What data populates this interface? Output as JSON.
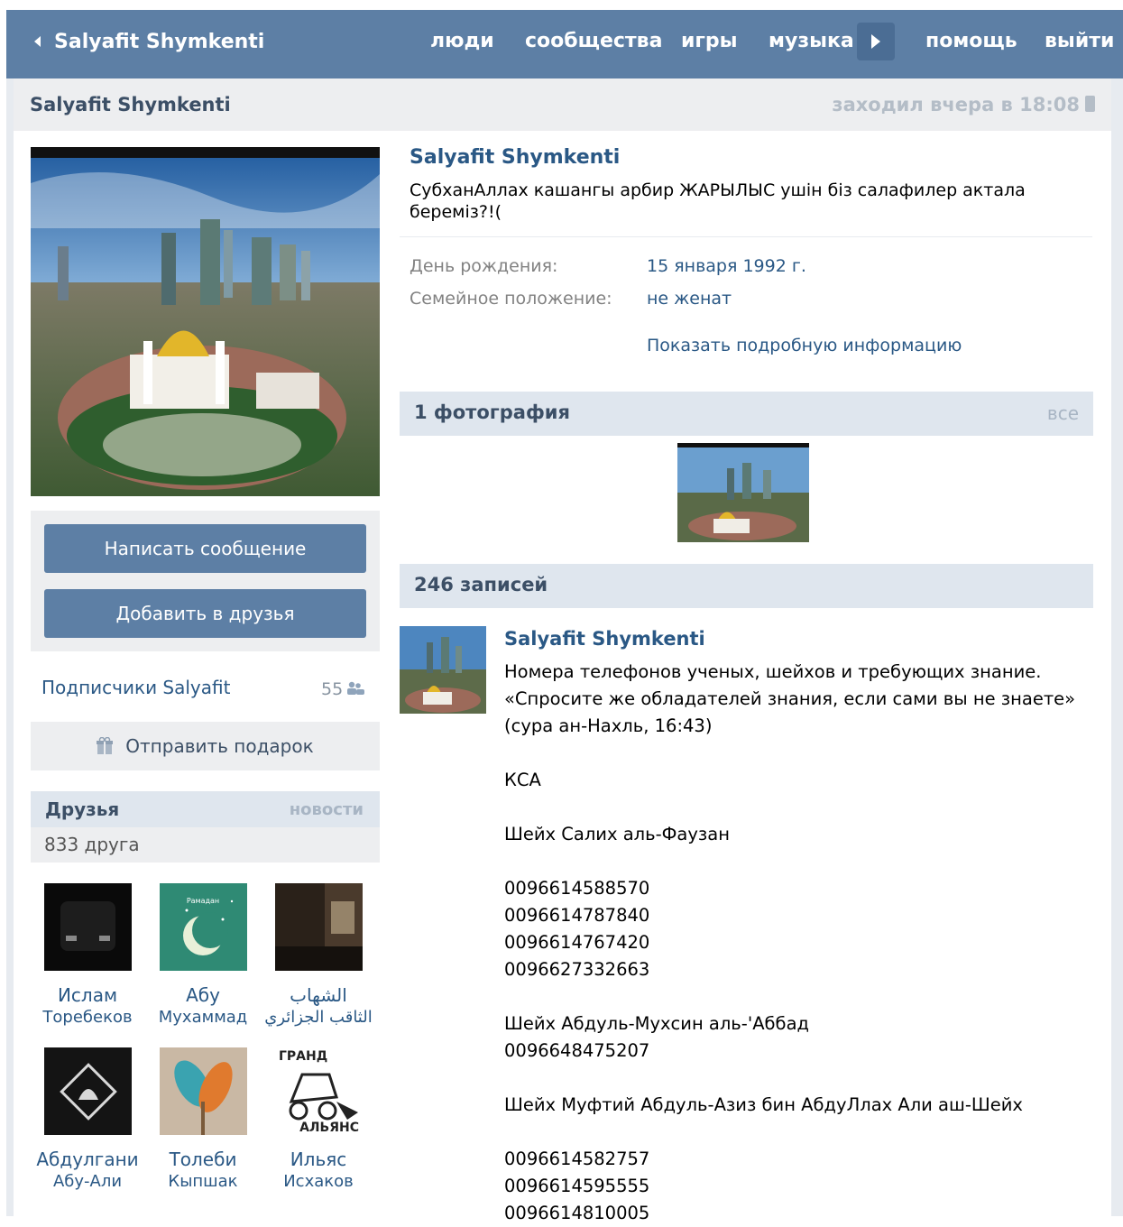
{
  "topbar": {
    "back_label": "Salyafit Shymkenti",
    "nav": [
      "люди",
      "сообщества",
      "игры",
      "музыка",
      "помощь",
      "выйти"
    ],
    "bg_color": "#5d7fa5"
  },
  "header": {
    "name": "Salyafit Shymkenti",
    "last_seen": "заходил вчера в 18:08"
  },
  "actions": {
    "message": "Написать сообщение",
    "add_friend": "Добавить в друзья",
    "subscribers_label": "Подписчики Salyafit",
    "subscribers_count": "55",
    "gift": "Отправить подарок"
  },
  "friends": {
    "title": "Друзья",
    "news": "новости",
    "count": "833 друга",
    "list": [
      {
        "first": "Ислам",
        "last": "Торебеков"
      },
      {
        "first": "Абу",
        "last": "Мухаммад"
      },
      {
        "first": "الشهاب",
        "last": "الثاقب الجزائري"
      },
      {
        "first": "Абдулгани",
        "last": "Абу-Али"
      },
      {
        "first": "Толеби",
        "last": "Кыпшак"
      },
      {
        "first": "Ильяс",
        "last": "Исхаков"
      }
    ],
    "avatar_text": {
      "tile2": "Рамадан",
      "tile6_top": "ГРАНД",
      "tile6_bottom": "АЛЬЯНС"
    }
  },
  "profile": {
    "name": "Salyafit Shymkenti",
    "status": "СубханАллах кашангы арбир ЖАРЫЛЫС ушін біз салафилер актала береміз?!(",
    "birthday_label": "День рождения:",
    "birthday_value": "15 января 1992 г.",
    "relationship_label": "Семейное положение:",
    "relationship_value": "не женат",
    "more_info": "Показать подробную информацию"
  },
  "photos": {
    "title": "1 фотография",
    "all": "все"
  },
  "wall": {
    "title": "246 записей",
    "post_author": "Salyafit Shymkenti",
    "post_text": "Номера телефонов ученых, шейхов и требующих знание.\n«Спросите же обладателей знания, если сами вы не знаете»\n(сура ан-Нахль, 16:43)\n\nКСА\n\nШейх Салих аль-Фаузан\n\n0096614588570\n0096614787840\n0096614767420\n0096627332663\n\nШейх Абдуль-Мухсин аль-'Аббад\n0096648475207\n\nШейх Муфтий Абдуль-Азиз бин АбдуЛлах Али аш-Шейх\n\n0096614582757\n0096614595555\n0096614810005"
  }
}
